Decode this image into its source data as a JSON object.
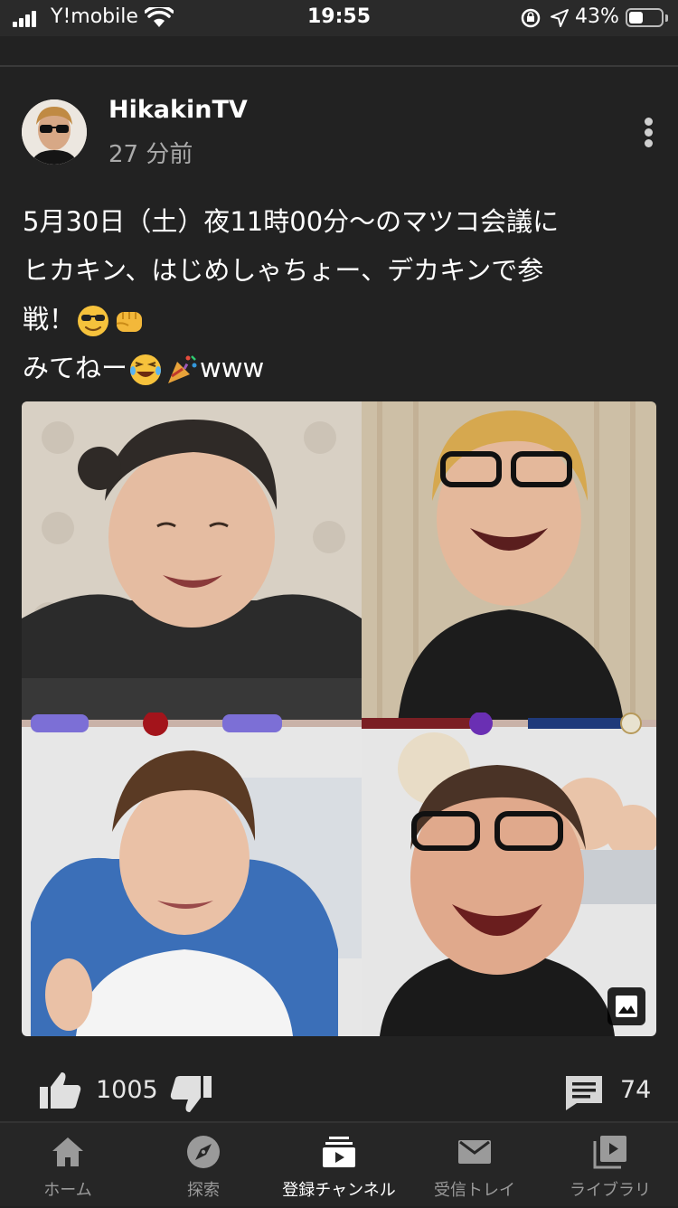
{
  "status_bar": {
    "carrier": "Y!mobile",
    "time": "19:55",
    "battery_percent_label": "43%",
    "battery_level": 0.43
  },
  "post": {
    "channel_name": "HikakinTV",
    "time_ago": "27 分前",
    "text_lines": [
      "5月30日（土）夜11時00分～のマツコ会議に",
      "ヒカキン、はじめしゃちょー、デカキンで参",
      "戦！",
      "みてねー"
    ],
    "text_suffix": "www",
    "emojis": [
      "sunglasses-emoji",
      "fist-emoji",
      "laughing-tears-emoji",
      "party-popper-emoji"
    ]
  },
  "actions": {
    "like_count": "1005",
    "comment_count": "74"
  },
  "nav": {
    "items": [
      {
        "label": "ホーム",
        "icon": "home-icon"
      },
      {
        "label": "探索",
        "icon": "explore-icon"
      },
      {
        "label": "登録チャンネル",
        "icon": "subscriptions-icon",
        "active": true
      },
      {
        "label": "受信トレイ",
        "icon": "inbox-icon"
      },
      {
        "label": "ライブラリ",
        "icon": "library-icon"
      }
    ]
  },
  "colors": {
    "background": "#222222",
    "status_bar": "#2a2a2a",
    "nav_bar": "#262626",
    "text_primary": "#ffffff",
    "text_secondary": "#aaaaaa"
  }
}
